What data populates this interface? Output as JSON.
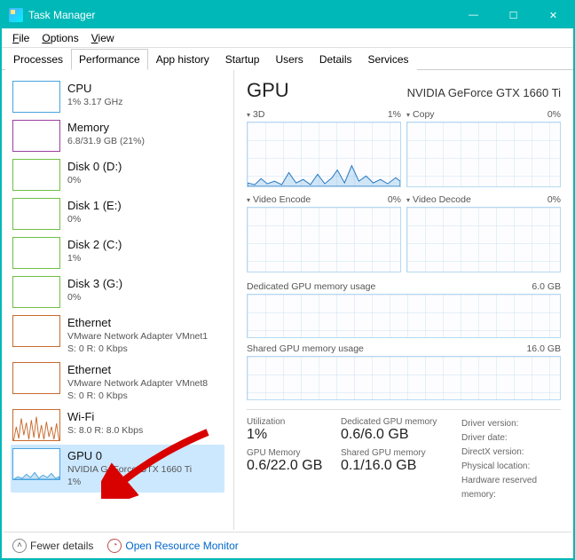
{
  "window": {
    "title": "Task Manager"
  },
  "menu": {
    "file": "File",
    "options": "Options",
    "view": "View"
  },
  "tabs": {
    "processes": "Processes",
    "performance": "Performance",
    "apphistory": "App history",
    "startup": "Startup",
    "users": "Users",
    "details": "Details",
    "services": "Services"
  },
  "sidebar": [
    {
      "name": "CPU",
      "sub1": "1% 3.17 GHz",
      "color": "#4aa3df"
    },
    {
      "name": "Memory",
      "sub1": "6.8/31.9 GB (21%)",
      "color": "#9b3fa0"
    },
    {
      "name": "Disk 0 (D:)",
      "sub1": "0%",
      "color": "#6fbf44"
    },
    {
      "name": "Disk 1 (E:)",
      "sub1": "0%",
      "color": "#6fbf44"
    },
    {
      "name": "Disk 2 (C:)",
      "sub1": "1%",
      "color": "#6fbf44"
    },
    {
      "name": "Disk 3 (G:)",
      "sub1": "0%",
      "color": "#6fbf44"
    },
    {
      "name": "Ethernet",
      "sub1": "VMware Network Adapter VMnet1",
      "sub2": "S: 0 R: 0 Kbps",
      "color": "#c86a2e"
    },
    {
      "name": "Ethernet",
      "sub1": "VMware Network Adapter VMnet8",
      "sub2": "S: 0 R: 0 Kbps",
      "color": "#c86a2e"
    },
    {
      "name": "Wi-Fi",
      "sub1": "S: 8.0 R: 8.0 Kbps",
      "color": "#c86a2e",
      "wifi": true
    },
    {
      "name": "GPU 0",
      "sub1": "NVIDIA GeForce GTX 1660 Ti",
      "sub2": "1%",
      "color": "#4aa3df",
      "selected": true,
      "gpu": true
    }
  ],
  "main": {
    "title": "GPU",
    "subtitle": "NVIDIA GeForce GTX 1660 Ti",
    "charts": [
      {
        "label": "3D",
        "pct": "1%",
        "active": true
      },
      {
        "label": "Copy",
        "pct": "0%"
      },
      {
        "label": "Video Encode",
        "pct": "0%"
      },
      {
        "label": "Video Decode",
        "pct": "0%"
      }
    ],
    "mem": [
      {
        "label": "Dedicated GPU memory usage",
        "right": "6.0 GB"
      },
      {
        "label": "Shared GPU memory usage",
        "right": "16.0 GB"
      }
    ],
    "stats": {
      "util_lbl": "Utilization",
      "util_val": "1%",
      "dedmem_lbl": "Dedicated GPU memory",
      "dedmem_val": "0.6/6.0 GB",
      "drvver_lbl": "Driver version:",
      "gpumem_lbl": "GPU Memory",
      "gpumem_val": "0.6/22.0 GB",
      "shrmem_lbl": "Shared GPU memory",
      "shrmem_val": "0.1/16.0 GB",
      "drvdate_lbl": "Driver date:",
      "directx_lbl": "DirectX version:",
      "physloc_lbl": "Physical location:",
      "hwres_lbl": "Hardware reserved memory:"
    }
  },
  "footer": {
    "fewer": "Fewer details",
    "monitor": "Open Resource Monitor"
  }
}
